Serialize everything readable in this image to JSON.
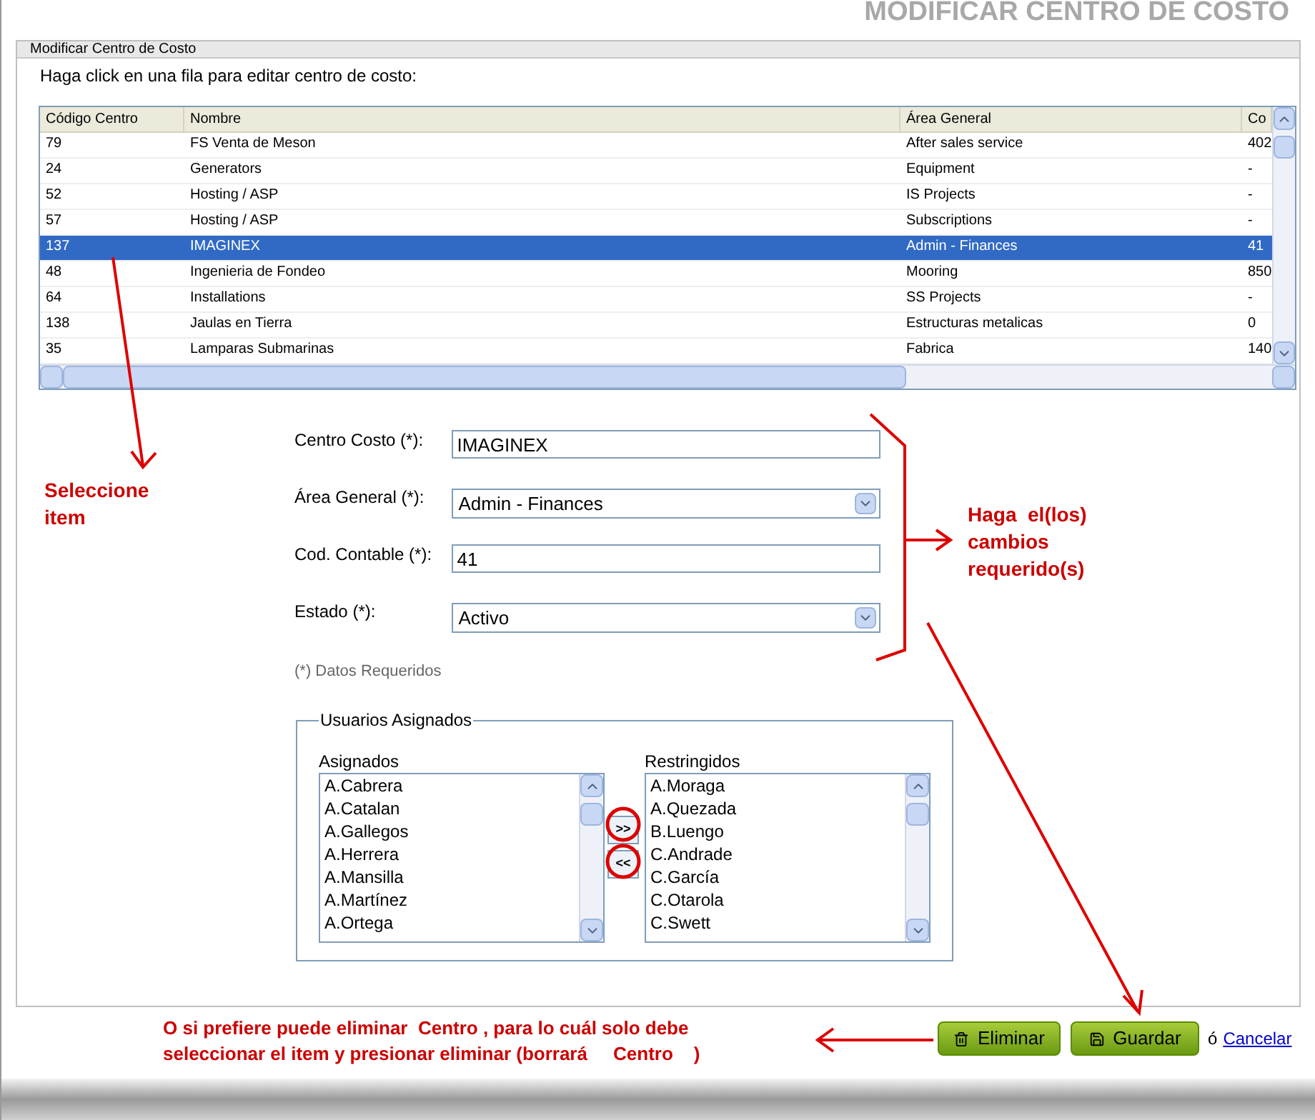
{
  "page_title": "MODIFICAR CENTRO DE COSTO",
  "panel": {
    "title": "Modificar Centro de Costo",
    "instruction": "Haga click en una fila para editar centro de costo:"
  },
  "table": {
    "columns": [
      "Código Centro",
      "Nombre",
      "Área General",
      "Co"
    ],
    "rows": [
      {
        "cells": [
          "79",
          "FS Venta de Meson",
          "After sales service",
          "402"
        ],
        "selected": false
      },
      {
        "cells": [
          "24",
          "Generators",
          "Equipment",
          "-"
        ],
        "selected": false
      },
      {
        "cells": [
          "52",
          "Hosting / ASP",
          "IS Projects",
          "-"
        ],
        "selected": false
      },
      {
        "cells": [
          "57",
          "Hosting / ASP",
          "Subscriptions",
          "-"
        ],
        "selected": false
      },
      {
        "cells": [
          "137",
          "IMAGINEX",
          "Admin - Finances",
          "41"
        ],
        "selected": true
      },
      {
        "cells": [
          "48",
          "Ingenieria de Fondeo",
          "Mooring",
          "850"
        ],
        "selected": false
      },
      {
        "cells": [
          "64",
          "Installations",
          "SS Projects",
          "-"
        ],
        "selected": false
      },
      {
        "cells": [
          "138",
          "Jaulas en Tierra",
          "Estructuras metalicas",
          "0"
        ],
        "selected": false
      },
      {
        "cells": [
          "35",
          "Lamparas Submarinas",
          "Fabrica",
          "140"
        ],
        "selected": false
      }
    ]
  },
  "form": {
    "fields": [
      {
        "label": "Centro Costo (*):",
        "kind": "text",
        "value": "IMAGINEX"
      },
      {
        "label": "Área General (*):",
        "kind": "select",
        "value": "Admin - Finances"
      },
      {
        "label": "Cod. Contable (*):",
        "kind": "text",
        "value": "41"
      },
      {
        "label": "Estado (*):",
        "kind": "select",
        "value": "Activo"
      }
    ],
    "required_note": "(*) Datos Requeridos"
  },
  "users": {
    "legend": "Usuarios Asignados",
    "assigned_label": "Asignados",
    "assigned": [
      "A.Cabrera",
      "A.Catalan",
      "A.Gallegos",
      "A.Herrera",
      "A.Mansilla",
      "A.Martínez",
      "A.Ortega"
    ],
    "restricted_label": "Restringidos",
    "restricted": [
      "A.Moraga",
      "A.Quezada",
      "B.Luengo",
      "C.Andrade",
      "C.García",
      "C.Otarola",
      "C.Swett"
    ],
    "move_right": ">>",
    "move_left": "<<"
  },
  "actions": {
    "delete": "Eliminar",
    "save": "Guardar",
    "or": "ó",
    "cancel": "Cancelar"
  },
  "annotations": {
    "select_item": "Seleccione item",
    "make_changes": "Haga  el(los) cambios requerido(s)",
    "delete_note_1": "O si prefiere puede eliminar  Centro , para lo cuál solo debe",
    "delete_note_2": "seleccionar el item y presionar eliminar (borrará     Centro    )"
  }
}
